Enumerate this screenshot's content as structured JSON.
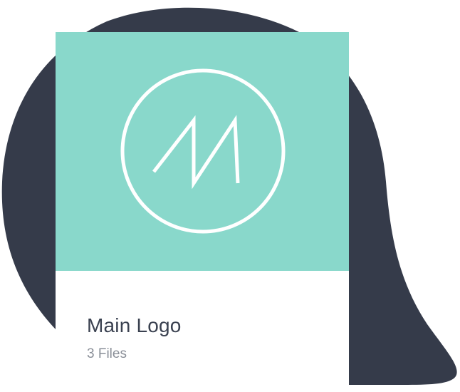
{
  "card": {
    "title": "Main Logo",
    "subtitle": "3 Files",
    "thumbnail_icon": "monogram-m-logo-icon"
  },
  "colors": {
    "blob": "#353b4a",
    "thumbnail_bg": "#89d8cb",
    "logo_stroke": "#ffffff",
    "card_bg": "#ffffff",
    "title_text": "#3a4150",
    "subtitle_text": "#8a8f98"
  }
}
